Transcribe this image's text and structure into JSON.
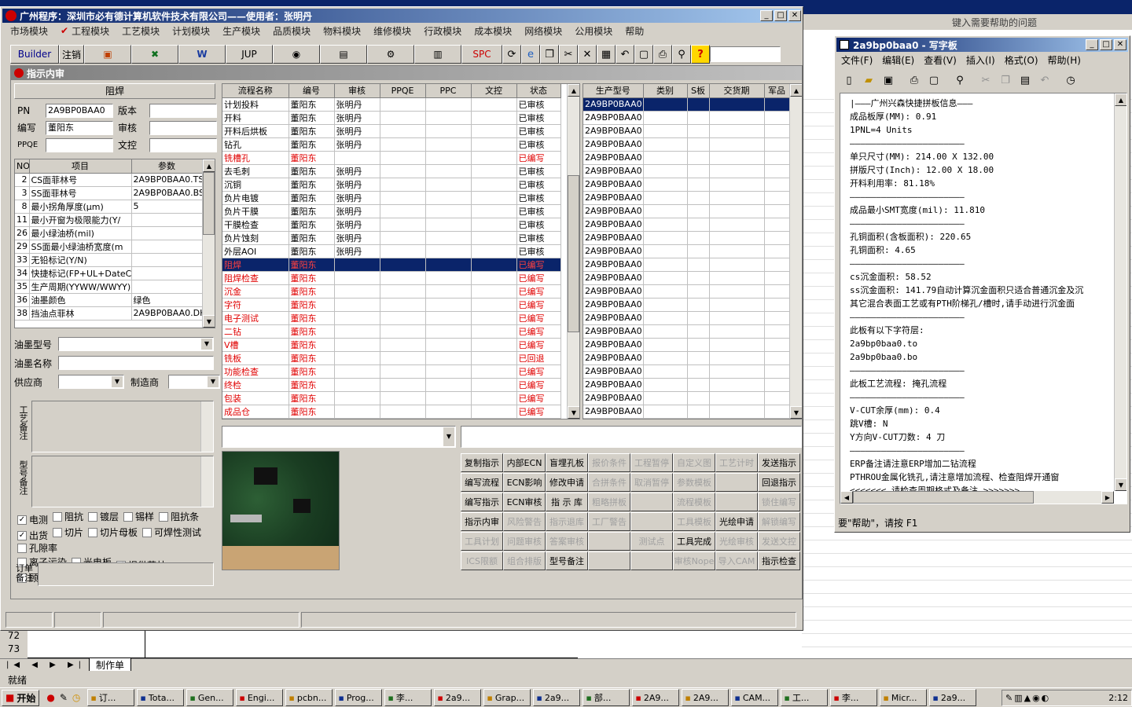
{
  "excel": {
    "help_hint": "键入需要帮助的问题",
    "sheet_tab": "制作单",
    "status": "就绪",
    "rows": [
      "72",
      "73"
    ]
  },
  "main": {
    "title": "广州程序：深圳市必有德计算机软件技术有限公司——使用者：张明丹",
    "menu": [
      "市场模块",
      "工程模块",
      "工艺模块",
      "计划模块",
      "生产模块",
      "品质模块",
      "物料模块",
      "维修模块",
      "行政模块",
      "成本模块",
      "网络模块",
      "公用模块",
      "帮助"
    ],
    "toolbar": [
      "Builder",
      "注销",
      "",
      "",
      "W",
      "JUP",
      "",
      "",
      "",
      "",
      "SPC",
      "",
      "",
      "",
      "",
      "",
      "",
      "",
      "",
      "",
      "",
      ""
    ],
    "sub_title": "指示内审",
    "left": {
      "header": "阻焊",
      "pn_label": "PN",
      "pn": "2A9BP0BAA0",
      "ver_label": "版本",
      "ver": "",
      "code_label": "编写",
      "code": "董阳东",
      "review_label": "审核",
      "review": "",
      "ppqe_label": "PPQE",
      "ppqe": "",
      "doc_label": "文控",
      "doc": "",
      "param_headers": [
        "NO",
        "项目",
        "参数"
      ],
      "params": [
        [
          "2",
          "CS面菲林号",
          "2A9BP0BAA0.TS"
        ],
        [
          "3",
          "SS面菲林号",
          "2A9BP0BAA0.BS"
        ],
        [
          "8",
          "最小拐角厚度(μm)",
          "5"
        ],
        [
          "11",
          "最小开窗为极限能力(Y/",
          ""
        ],
        [
          "26",
          "最小绿油桥(mil)",
          ""
        ],
        [
          "29",
          "SS面最小绿油桥宽度(m",
          ""
        ],
        [
          "33",
          "无铅标记(Y/N)",
          ""
        ],
        [
          "34",
          "快捷标记(FP+UL+DateCo",
          ""
        ],
        [
          "35",
          "生产周期(YYWW/WWYY)",
          ""
        ],
        [
          "36",
          "油墨颜色",
          "绿色"
        ],
        [
          "38",
          "挡油点菲林",
          "2A9BP0BAA0.DH"
        ]
      ],
      "ink_type": "油墨型号",
      "ink_name": "油墨名称",
      "supplier": "供应商",
      "maker": "制造商",
      "remark1": "工艺备注",
      "remark2": "型号备注",
      "order_remark": "订单备注",
      "checks": [
        [
          "电测",
          true
        ],
        [
          "阻抗",
          false
        ],
        [
          "镀层",
          false
        ],
        [
          "锡样",
          false
        ],
        [
          "阻抗条",
          false
        ],
        [
          "出货",
          true
        ],
        [
          "切片",
          false
        ],
        [
          "切片母板",
          false
        ],
        [
          "可焊性测试",
          false
        ],
        [
          "孔隙率",
          false
        ],
        [
          "离子污染",
          false
        ],
        [
          "光电板",
          false
        ],
        [
          "提供菲林",
          true
        ],
        [
          "顾客提供板材",
          false
        ]
      ]
    },
    "flow_headers": [
      "流程名称",
      "编号",
      "审核",
      "PPQE",
      "PPC",
      "文控",
      "状态"
    ],
    "flow": [
      [
        "计划投料",
        "董阳东",
        "张明丹",
        "",
        "",
        "",
        "已审核",
        0
      ],
      [
        "开料",
        "董阳东",
        "张明丹",
        "",
        "",
        "",
        "已审核",
        0
      ],
      [
        "开料后烘板",
        "董阳东",
        "张明丹",
        "",
        "",
        "",
        "已审核",
        0
      ],
      [
        "钻孔",
        "董阳东",
        "张明丹",
        "",
        "",
        "",
        "已审核",
        0
      ],
      [
        "铣槽孔",
        "董阳东",
        "",
        "",
        "",
        "",
        "已编写",
        1
      ],
      [
        "去毛刺",
        "董阳东",
        "张明丹",
        "",
        "",
        "",
        "已审核",
        0
      ],
      [
        "沉铜",
        "董阳东",
        "张明丹",
        "",
        "",
        "",
        "已审核",
        0
      ],
      [
        "负片电镀",
        "董阳东",
        "张明丹",
        "",
        "",
        "",
        "已审核",
        0
      ],
      [
        "负片干膜",
        "董阳东",
        "张明丹",
        "",
        "",
        "",
        "已审核",
        0
      ],
      [
        "干膜检查",
        "董阳东",
        "张明丹",
        "",
        "",
        "",
        "已审核",
        0
      ],
      [
        "负片蚀刻",
        "董阳东",
        "张明丹",
        "",
        "",
        "",
        "已审核",
        0
      ],
      [
        "外层AOI",
        "董阳东",
        "张明丹",
        "",
        "",
        "",
        "已审核",
        0
      ],
      [
        "阻焊",
        "董阳东",
        "",
        "",
        "",
        "",
        "已编写",
        2
      ],
      [
        "阻焊检查",
        "董阳东",
        "",
        "",
        "",
        "",
        "已编写",
        1
      ],
      [
        "沉金",
        "董阳东",
        "",
        "",
        "",
        "",
        "已编写",
        1
      ],
      [
        "字符",
        "董阳东",
        "",
        "",
        "",
        "",
        "已编写",
        1
      ],
      [
        "电子测试",
        "董阳东",
        "",
        "",
        "",
        "",
        "已编写",
        1
      ],
      [
        "二钻",
        "董阳东",
        "",
        "",
        "",
        "",
        "已编写",
        1
      ],
      [
        "V槽",
        "董阳东",
        "",
        "",
        "",
        "",
        "已编写",
        1
      ],
      [
        "铣板",
        "董阳东",
        "",
        "",
        "",
        "",
        "已回退",
        1
      ],
      [
        "功能检查",
        "董阳东",
        "",
        "",
        "",
        "",
        "已编写",
        1
      ],
      [
        "终检",
        "董阳东",
        "",
        "",
        "",
        "",
        "已编写",
        1
      ],
      [
        "包装",
        "董阳东",
        "",
        "",
        "",
        "",
        "已编写",
        1
      ],
      [
        "成品仓",
        "董阳东",
        "",
        "",
        "",
        "",
        "已编写",
        1
      ]
    ],
    "prod_headers": [
      "生产型号",
      "类别",
      "S板",
      "交货期",
      "军品"
    ],
    "prod_value": "2A9BP0BAA0",
    "prod_rows": 24,
    "actions": [
      [
        "复制指示",
        0
      ],
      [
        "内部ECN",
        0
      ],
      [
        "盲埋孔板",
        0
      ],
      [
        "报价条件",
        1
      ],
      [
        "工程暂停",
        1
      ],
      [
        "自定义图",
        1
      ],
      [
        "工艺计时",
        1
      ],
      [
        "发送指示",
        0
      ],
      [
        "编写流程",
        0
      ],
      [
        "ECN影响",
        0
      ],
      [
        "修改申请",
        0
      ],
      [
        "合拼条件",
        1
      ],
      [
        "取消暂停",
        1
      ],
      [
        "参数模板",
        1
      ],
      [
        "",
        1
      ],
      [
        "回退指示",
        0
      ],
      [
        "编写指示",
        0
      ],
      [
        "ECN审核",
        0
      ],
      [
        "指 示 库",
        0
      ],
      [
        "粗略拼板",
        1
      ],
      [
        "",
        1
      ],
      [
        "流程模板",
        1
      ],
      [
        "",
        1
      ],
      [
        "锁住编写",
        1
      ],
      [
        "指示内审",
        0
      ],
      [
        "风险警告",
        1
      ],
      [
        "指示退库",
        1
      ],
      [
        "工厂警告",
        1
      ],
      [
        "",
        1
      ],
      [
        "工具模板",
        1
      ],
      [
        "光绘申请",
        0
      ],
      [
        "解锁编写",
        1
      ],
      [
        "工具计划",
        1
      ],
      [
        "问题审核",
        1
      ],
      [
        "答案审核",
        1
      ],
      [
        "",
        1
      ],
      [
        "测试点",
        1
      ],
      [
        "工具完成",
        0
      ],
      [
        "光绘审核",
        1
      ],
      [
        "发送文控",
        1
      ],
      [
        "ICS限额",
        1
      ],
      [
        "组合排版",
        1
      ],
      [
        "型号备注",
        0
      ],
      [
        "",
        1
      ],
      [
        "",
        1
      ],
      [
        "审核Nope",
        1
      ],
      [
        "导入CAM",
        1
      ],
      [
        "指示检查",
        0
      ]
    ]
  },
  "notepad": {
    "title": "2a9bp0baa0 - 写字板",
    "menu": [
      "文件(F)",
      "编辑(E)",
      "查看(V)",
      "插入(I)",
      "格式(O)",
      "帮助(H)"
    ],
    "status": "要\"帮助\"，请按 F1",
    "lines": [
      "|———广州兴森快捷拼板信息———",
      "成品板厚(MM): 0.91",
      "1PNL=4 Units",
      "——————————————————————",
      "单只尺寸(MM): 214.00 X 132.00",
      "拼版尺寸(Inch): 12.00 X 18.00",
      "开料利用率: 81.18%",
      "——————————————————————",
      "成品最小SMT宽度(mil): 11.810",
      "——————————————————————",
      "孔铜面积(含板面积): 220.65",
      "孔铜面积: 4.65",
      "——————————————————————",
      "cs沉金面积: 58.52",
      "ss沉金面积: 141.79自动计算沉金面积只适合普通沉金及沉",
      "其它混合表面工艺或有PTH阶梯孔/槽时,请手动进行沉金面",
      "——————————————————————",
      "此板有以下字符层:",
      "2a9bp0baa0.to",
      "2a9bp0baa0.bo",
      "——————————————————————",
      "此板工艺流程: 掩孔流程",
      "——————————————————————",
      "V-CUT余厚(mm): 0.4",
      "跳V槽: N",
      "Y方向V-CUT刀数: 4 刀",
      "——————————————————————",
      "ERP备注请注意ERP增加二钻流程",
      "PTHROU金属化铣孔,请注意增加流程、检查阻焊开通窗",
      "<<<<<<<_请检查周期格式及备注_>>>>>>>"
    ]
  },
  "taskbar": {
    "start": "开始",
    "tasks": [
      "订...",
      "Tota...",
      "Gen...",
      "Engi...",
      "pcbn...",
      "Prog...",
      "李...",
      "2a9...",
      "Grap...",
      "2a9...",
      "部...",
      "2A9...",
      "2A9...",
      "CAM...",
      "工...",
      "李...",
      "Micr...",
      "2a9..."
    ],
    "clock": "2:12"
  }
}
